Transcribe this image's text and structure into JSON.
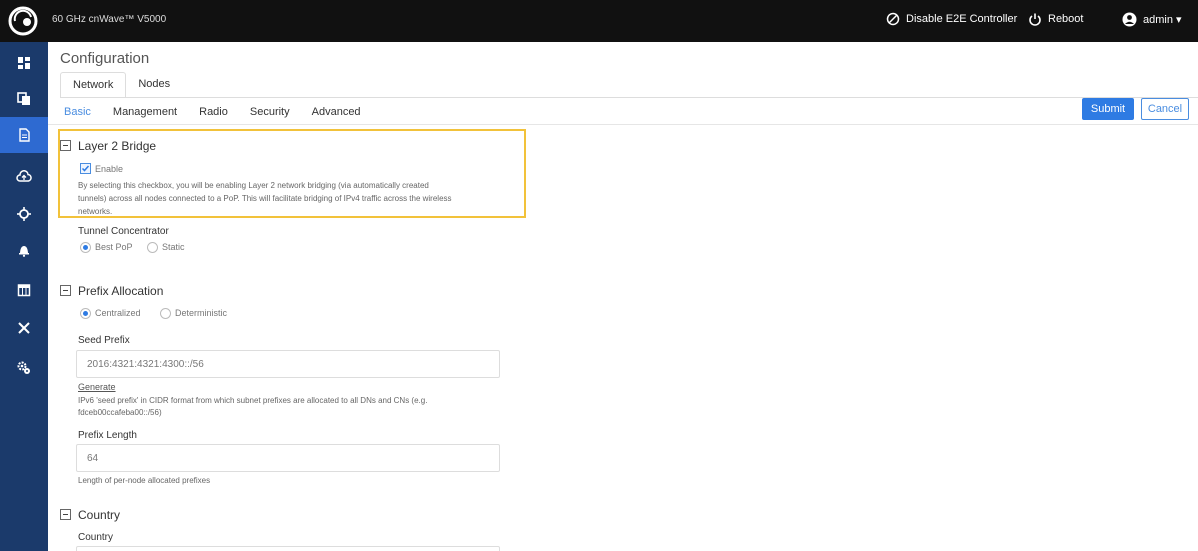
{
  "app": {
    "product_name": "60 GHz cnWave™ V5000"
  },
  "topbar": {
    "disable_e2e_label": "Disable E2E Controller",
    "reboot_label": "Reboot",
    "user_label": "admin ▾"
  },
  "sidebar": {
    "items": [
      {
        "icon": "dashboard-icon"
      },
      {
        "icon": "copy-icon"
      },
      {
        "icon": "document-icon",
        "active": true
      },
      {
        "icon": "cloud-icon"
      },
      {
        "icon": "crosshair-icon"
      },
      {
        "icon": "bell-icon"
      },
      {
        "icon": "calendar-icon"
      },
      {
        "icon": "tools-icon"
      },
      {
        "icon": "gears-icon"
      }
    ]
  },
  "page": {
    "title": "Configuration",
    "tabs": [
      "Network",
      "Nodes"
    ],
    "subtabs": [
      "Basic",
      "Management",
      "Radio",
      "Security",
      "Advanced"
    ],
    "submit_label": "Submit",
    "cancel_label": "Cancel"
  },
  "layer2": {
    "title": "Layer 2 Bridge",
    "enable_label": "Enable",
    "description_line1": "By selecting this checkbox, you will be enabling Layer 2 network bridging (via automatically created",
    "description_line2": "tunnels) across all nodes connected to a PoP. This will facilitate bridging of IPv4 traffic across the wireless",
    "description_line3": "networks.",
    "tunnel_label": "Tunnel Concentrator",
    "tunnel_options": [
      "Best PoP",
      "Static"
    ],
    "tunnel_selected": "Best PoP"
  },
  "prefix": {
    "title": "Prefix Allocation",
    "options": [
      "Centralized",
      "Deterministic"
    ],
    "selected": "Centralized",
    "seed_label": "Seed Prefix",
    "seed_value": "2016:4321:4321:4300::/56",
    "generate_label": "Generate",
    "seed_help_line1": "IPv6 'seed prefix' in CIDR format from which subnet prefixes are allocated to all DNs and CNs (e.g.",
    "seed_help_line2": "fdceb00ccafeba00::/56)",
    "length_label": "Prefix Length",
    "length_value": "64",
    "length_help": "Length of per-node allocated prefixes"
  },
  "country": {
    "title": "Country",
    "label": "Country"
  },
  "colors": {
    "topbar": "#111111",
    "sidebar": "#1b3a6b",
    "accent": "#2e7be3",
    "highlight": "#f2c23a"
  }
}
